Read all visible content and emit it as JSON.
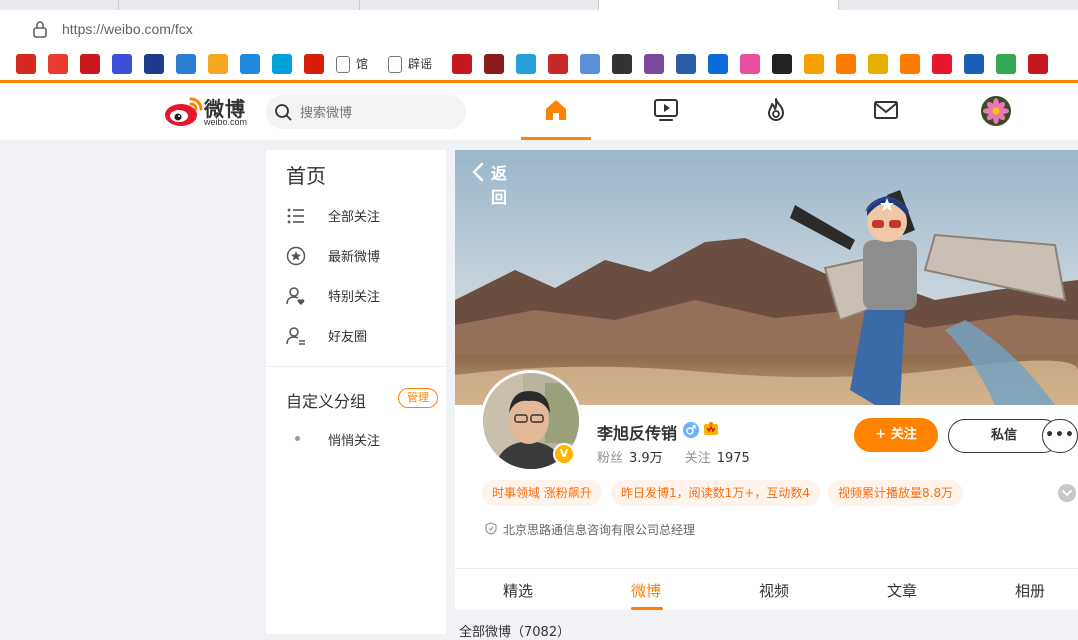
{
  "browser": {
    "url": "https://weibo.com/fcx",
    "bookmarks": [
      {
        "icon": "cnhr-icon",
        "color": "#d5281f",
        "text": ""
      },
      {
        "icon": "toutiao-icon",
        "color": "#e93a2e",
        "text": ""
      },
      {
        "icon": "red-seal-icon",
        "color": "#c9171e",
        "text": ""
      },
      {
        "icon": "sigma-icon",
        "color": "#3b4fd8",
        "text": ""
      },
      {
        "icon": "crc-icon",
        "color": "#1d3b8c",
        "text": ""
      },
      {
        "icon": "pattern-icon",
        "color": "#2a7ed0",
        "text": ""
      },
      {
        "icon": "search-globe-icon",
        "color": "#f5a623",
        "text": ""
      },
      {
        "icon": "edge-icon",
        "color": "#1f8be0",
        "text": ""
      },
      {
        "icon": "bilibili-icon",
        "color": "#00a1d6",
        "text": ""
      },
      {
        "icon": "stripe-icon",
        "color": "#d81e06",
        "text": ""
      }
    ],
    "bookmark_texts": [
      "馆",
      "辟谣"
    ],
    "bookmark_icons_right": [
      {
        "icon": "cfi-icon",
        "color": "#c4161c"
      },
      {
        "icon": "calligraphy-icon",
        "color": "#8b1a1a"
      },
      {
        "icon": "d-icon",
        "color": "#24a0d8"
      },
      {
        "icon": "grid-icon",
        "color": "#c62828"
      },
      {
        "icon": "question-icon",
        "color": "#5b8ed6"
      },
      {
        "icon": "swoosh-icon",
        "color": "#333333"
      },
      {
        "icon": "house-icon",
        "color": "#7b4a9e"
      },
      {
        "icon": "emblem-icon",
        "color": "#2a5caa"
      },
      {
        "icon": "bing-icon",
        "color": "#0a6cd8"
      },
      {
        "icon": "q-icon",
        "color": "#e84f9c"
      },
      {
        "icon": "pin-icon",
        "color": "#222222"
      },
      {
        "icon": "sohu-icon",
        "color": "#f7a000"
      },
      {
        "icon": "shen-icon",
        "color": "#ff7a00"
      },
      {
        "icon": "star-icon",
        "color": "#e5b000"
      },
      {
        "icon": "paper-plane-icon",
        "color": "#ff7b00"
      },
      {
        "icon": "weibo-icon",
        "color": "#e6162d"
      },
      {
        "icon": "news-icon",
        "color": "#1a5fb4"
      },
      {
        "icon": "chrome-icon",
        "color": "#34a853"
      },
      {
        "icon": "red-star-icon",
        "color": "#c4161c"
      }
    ]
  },
  "weibo": {
    "accent": "#ff8200",
    "logo_text": "微博",
    "logo_domain": "weibo.com",
    "search_placeholder": "搜索微博",
    "nav": [
      "home-icon",
      "video-icon",
      "hot-icon",
      "message-icon"
    ]
  },
  "sidebar": {
    "title": "首页",
    "items": [
      {
        "label": "全部关注",
        "icon": "list-icon"
      },
      {
        "label": "最新微博",
        "icon": "star-circle-icon"
      },
      {
        "label": "特别关注",
        "icon": "user-heart-icon"
      },
      {
        "label": "好友圈",
        "icon": "user-friends-icon"
      }
    ],
    "group_title": "自定义分组",
    "manage": "管理",
    "group_items": [
      {
        "label": "悄悄关注"
      }
    ]
  },
  "profile": {
    "back": "返回",
    "name": "李旭反传销",
    "fans_label": "粉丝",
    "fans": "3.9万",
    "follow_label": "关注",
    "follow_count": "1975",
    "follow_btn": "+ 关注",
    "message_btn": "私信",
    "more": "•••",
    "tags": [
      "时事领域 涨粉飙升",
      "昨日发博1，阅读数1万+，互动数4",
      "视频累计播放量8.8万"
    ],
    "company": "北京思路通信息咨询有限公司总经理",
    "tabs": [
      "精选",
      "微博",
      "视频",
      "文章",
      "相册"
    ],
    "active_tab": "微博",
    "feed_header": "全部微博（7082）"
  }
}
